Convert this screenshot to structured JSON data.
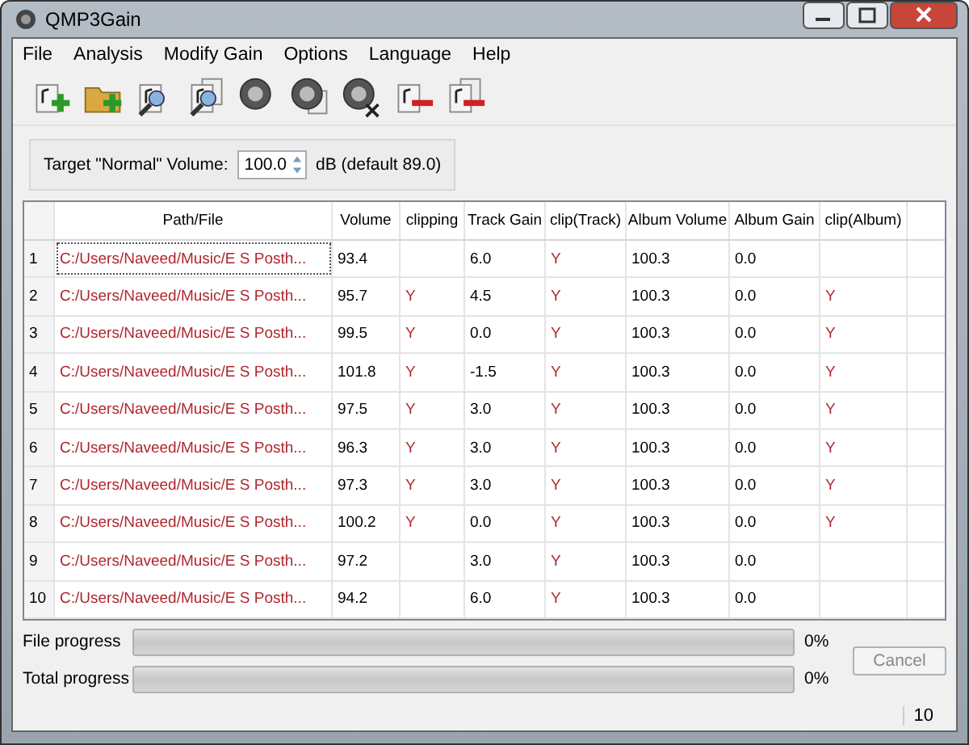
{
  "window": {
    "title": "QMP3Gain"
  },
  "menu": [
    "File",
    "Analysis",
    "Modify Gain",
    "Options",
    "Language",
    "Help"
  ],
  "toolbar": [
    {
      "kind": "file-plus"
    },
    {
      "kind": "folder-plus"
    },
    {
      "kind": "file-search"
    },
    {
      "kind": "files-search"
    },
    {
      "kind": "knob"
    },
    {
      "kind": "knobs"
    },
    {
      "kind": "knob-x"
    },
    {
      "kind": "file-minus"
    },
    {
      "kind": "files-minus"
    }
  ],
  "target": {
    "label": "Target \"Normal\" Volume:",
    "value": "100.0",
    "unit": "dB (default 89.0)"
  },
  "table": {
    "columns": [
      "Path/File",
      "Volume",
      "clipping",
      "Track Gain",
      "clip(Track)",
      "Album Volume",
      "Album Gain",
      "clip(Album)"
    ],
    "rows": [
      {
        "num": "1",
        "path": "C:/Users/Naveed/Music/E S Posth...",
        "volume": "93.4",
        "track_gain": "6.0",
        "clip_track": "Y",
        "album_volume": "100.3",
        "album_gain": "0.0",
        "focused": true
      },
      {
        "num": "2",
        "path": "C:/Users/Naveed/Music/E S Posth...",
        "volume": "95.7",
        "clipping": "Y",
        "track_gain": "4.5",
        "clip_track": "Y",
        "album_volume": "100.3",
        "album_gain": "0.0",
        "clip_album": "Y",
        "focused": false
      },
      {
        "num": "3",
        "path": "C:/Users/Naveed/Music/E S Posth...",
        "volume": "99.5",
        "clipping": "Y",
        "track_gain": "0.0",
        "clip_track": "Y",
        "album_volume": "100.3",
        "album_gain": "0.0",
        "clip_album": "Y",
        "focused": false
      },
      {
        "num": "4",
        "path": "C:/Users/Naveed/Music/E S Posth...",
        "volume": "101.8",
        "clipping": "Y",
        "track_gain": "-1.5",
        "clip_track": "Y",
        "album_volume": "100.3",
        "album_gain": "0.0",
        "clip_album": "Y",
        "focused": false
      },
      {
        "num": "5",
        "path": "C:/Users/Naveed/Music/E S Posth...",
        "volume": "97.5",
        "clipping": "Y",
        "track_gain": "3.0",
        "clip_track": "Y",
        "album_volume": "100.3",
        "album_gain": "0.0",
        "clip_album": "Y",
        "focused": false
      },
      {
        "num": "6",
        "path": "C:/Users/Naveed/Music/E S Posth...",
        "volume": "96.3",
        "clipping": "Y",
        "track_gain": "3.0",
        "clip_track": "Y",
        "album_volume": "100.3",
        "album_gain": "0.0",
        "clip_album": "Y",
        "focused": false
      },
      {
        "num": "7",
        "path": "C:/Users/Naveed/Music/E S Posth...",
        "volume": "97.3",
        "clipping": "Y",
        "track_gain": "3.0",
        "clip_track": "Y",
        "album_volume": "100.3",
        "album_gain": "0.0",
        "clip_album": "Y",
        "focused": false
      },
      {
        "num": "8",
        "path": "C:/Users/Naveed/Music/E S Posth...",
        "volume": "100.2",
        "clipping": "Y",
        "track_gain": "0.0",
        "clip_track": "Y",
        "album_volume": "100.3",
        "album_gain": "0.0",
        "clip_album": "Y",
        "focused": false
      },
      {
        "num": "9",
        "path": "C:/Users/Naveed/Music/E S Posth...",
        "volume": "97.2",
        "track_gain": "3.0",
        "clip_track": "Y",
        "album_volume": "100.3",
        "album_gain": "0.0",
        "focused": false
      },
      {
        "num": "10",
        "path": "C:/Users/Naveed/Music/E S Posth...",
        "volume": "94.2",
        "track_gain": "6.0",
        "clip_track": "Y",
        "album_volume": "100.3",
        "album_gain": "0.0",
        "focused": false
      }
    ]
  },
  "progress": [
    {
      "label": "File progress",
      "level": 0,
      "reading": "0%"
    },
    {
      "label": "Total progress",
      "level": 0,
      "reading": "0%"
    }
  ],
  "cancel": {
    "label": "Cancel",
    "disabled": true
  },
  "status_bar": {
    "count": "10"
  }
}
